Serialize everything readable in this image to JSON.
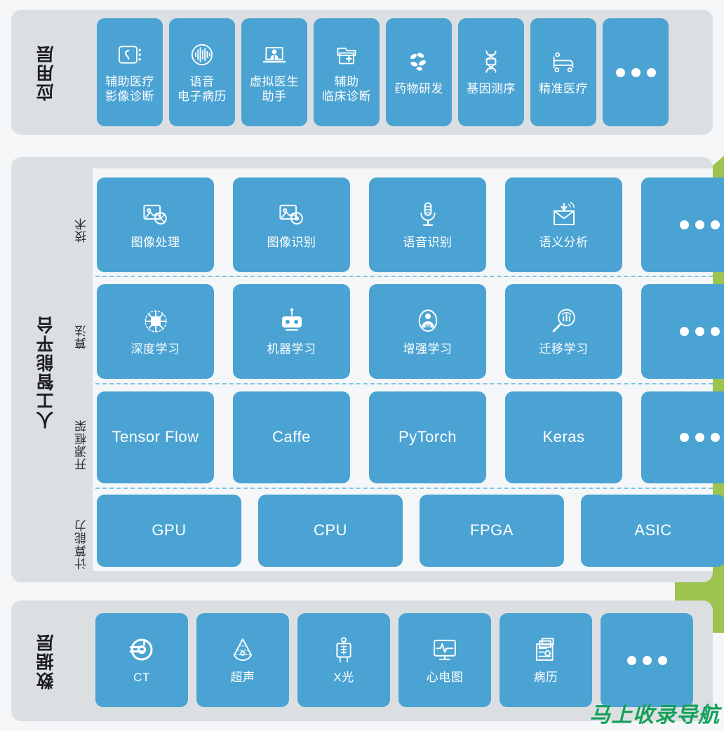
{
  "theme": {
    "card_blue": "#4ba3d3",
    "panel_gray": "#dcdfe2",
    "page_bg": "#f4f6f7",
    "accent_green": "#9cc44e",
    "watermark_green": "#13a05a",
    "dashed_blue": "#7fc4e0"
  },
  "watermark": {
    "text": "马上收录导航"
  },
  "layers": {
    "application": {
      "label": "应用层",
      "cards": [
        {
          "icon": "medical-imaging-icon",
          "label": "辅助医疗\n影像诊断"
        },
        {
          "icon": "voice-waveform-icon",
          "label": "语音\n电子病历"
        },
        {
          "icon": "virtual-doctor-icon",
          "label": "虚拟医生\n助手"
        },
        {
          "icon": "clinical-folder-icon",
          "label": "辅助\n临床诊断"
        },
        {
          "icon": "pills-icon",
          "label": "药物研发"
        },
        {
          "icon": "dna-helix-icon",
          "label": "基因测序"
        },
        {
          "icon": "hospital-bed-icon",
          "label": "精准医疗"
        },
        {
          "icon": "ellipsis-icon",
          "label": ""
        }
      ]
    },
    "ai_platform": {
      "label": "人工智能平台",
      "rows": [
        {
          "sub_label": "技术",
          "cards": [
            {
              "icon": "image-processing-icon",
              "label": "图像处理"
            },
            {
              "icon": "image-recognition-icon",
              "label": "图像识别"
            },
            {
              "icon": "microphone-icon",
              "label": "语音识别"
            },
            {
              "icon": "semantic-envelope-icon",
              "label": "语义分析"
            },
            {
              "icon": "ellipsis-icon",
              "label": ""
            }
          ]
        },
        {
          "sub_label": "算法",
          "cards": [
            {
              "icon": "neural-chip-icon",
              "label": "深度学习"
            },
            {
              "icon": "robot-icon",
              "label": "机器学习"
            },
            {
              "icon": "person-badge-icon",
              "label": "增强学习"
            },
            {
              "icon": "magnifier-chart-icon",
              "label": "迁移学习"
            },
            {
              "icon": "ellipsis-icon",
              "label": ""
            }
          ]
        },
        {
          "sub_label": "开源框架",
          "cards": [
            {
              "icon": "",
              "label": "Tensor Flow"
            },
            {
              "icon": "",
              "label": "Caffe"
            },
            {
              "icon": "",
              "label": "PyTorch"
            },
            {
              "icon": "",
              "label": "Keras"
            },
            {
              "icon": "ellipsis-icon",
              "label": ""
            }
          ]
        },
        {
          "sub_label": "计算能力",
          "cards": [
            {
              "icon": "",
              "label": "GPU"
            },
            {
              "icon": "",
              "label": "CPU"
            },
            {
              "icon": "",
              "label": "FPGA"
            },
            {
              "icon": "",
              "label": "ASIC"
            }
          ]
        }
      ]
    },
    "data": {
      "label": "数据层",
      "cards": [
        {
          "icon": "ct-scanner-icon",
          "label": "CT"
        },
        {
          "icon": "ultrasound-icon",
          "label": "超声"
        },
        {
          "icon": "xray-icon",
          "label": "X光"
        },
        {
          "icon": "ecg-monitor-icon",
          "label": "心电图"
        },
        {
          "icon": "medical-records-icon",
          "label": "病历"
        },
        {
          "icon": "ellipsis-icon",
          "label": ""
        }
      ]
    }
  }
}
